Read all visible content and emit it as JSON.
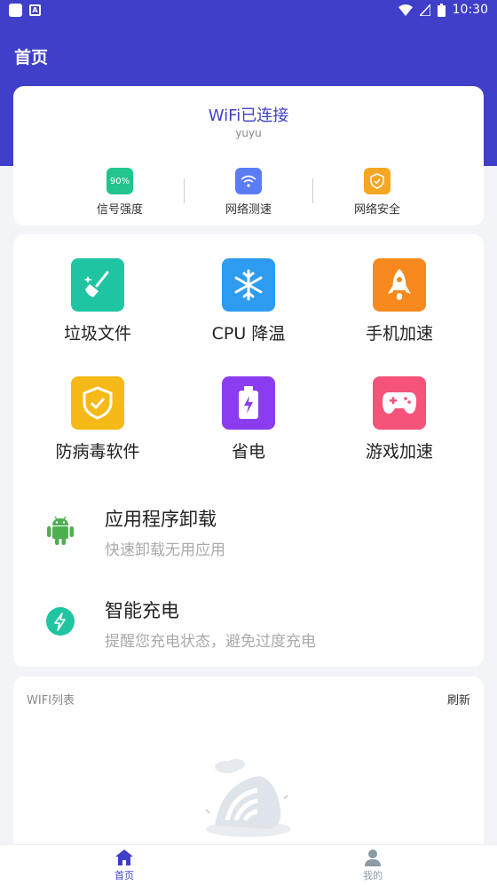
{
  "status_bar": {
    "time": "10:30"
  },
  "header": {
    "title": "首页"
  },
  "wifi": {
    "status": "WiFi已连接",
    "ssid": "yuyu",
    "quick": [
      {
        "label": "信号强度",
        "badge": "90%",
        "color": "#23c48e",
        "icon": "signal-strength-icon"
      },
      {
        "label": "网络测速",
        "color": "#5b7cf5",
        "icon": "wifi-icon"
      },
      {
        "label": "网络安全",
        "color": "#f5a623",
        "icon": "shield-icon"
      }
    ]
  },
  "tools": [
    {
      "label": "垃圾文件",
      "color": "#1fc4a3",
      "icon": "broom-icon"
    },
    {
      "label": "CPU 降温",
      "color": "#2d9cf0",
      "icon": "snowflake-icon"
    },
    {
      "label": "手机加速",
      "color": "#f7891f",
      "icon": "rocket-icon"
    },
    {
      "label": "防病毒软件",
      "color": "#f5b918",
      "icon": "shield-check-icon"
    },
    {
      "label": "省电",
      "color": "#8b3cf0",
      "icon": "battery-icon"
    },
    {
      "label": "游戏加速",
      "color": "#f5537a",
      "icon": "gamepad-icon"
    }
  ],
  "features": [
    {
      "title": "应用程序卸载",
      "subtitle": "快速卸载无用应用",
      "icon": "android-icon",
      "color": "#4caf50"
    },
    {
      "title": "智能充电",
      "subtitle": "提醒您充电状态，避免过度充电",
      "icon": "lightning-icon",
      "color": "#1fc4a3"
    }
  ],
  "wifi_list": {
    "title": "WIFI列表",
    "refresh": "刷新"
  },
  "nav": [
    {
      "label": "首页",
      "icon": "home-icon",
      "active": true
    },
    {
      "label": "我的",
      "icon": "person-icon",
      "active": false
    }
  ],
  "theme": {
    "primary": "#3f3fc9",
    "inactive": "#8a9aa6"
  }
}
